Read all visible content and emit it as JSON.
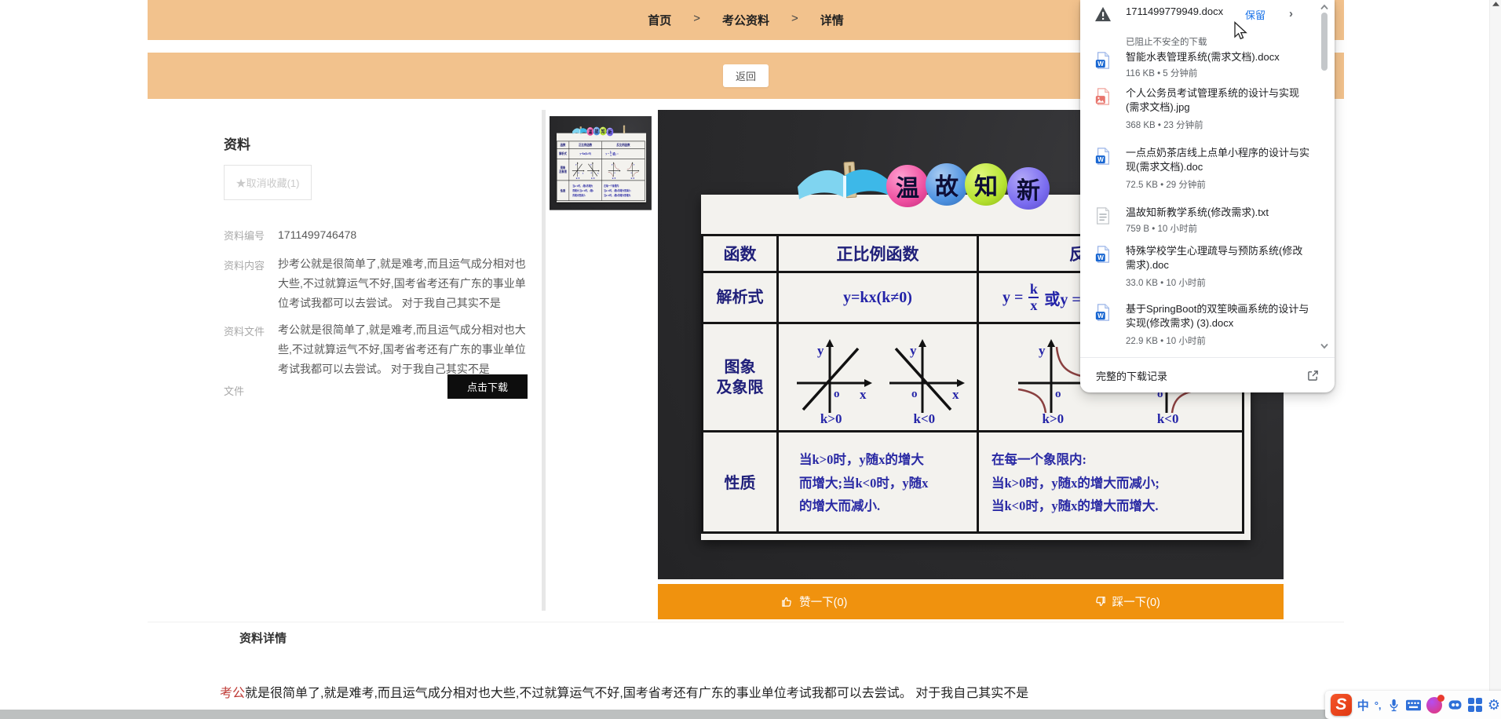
{
  "colors": {
    "header_band": "#f2c28d",
    "accent_orange": "#f0920e",
    "link_blue": "#1a73e8",
    "highlight_red": "#bf3b36",
    "download_button_black": "#0d0d0d"
  },
  "header": {
    "breadcrumb": [
      "首页",
      "考公资料",
      "详情"
    ],
    "separator": ">",
    "back_button": "返回"
  },
  "material_panel": {
    "title": "资料",
    "star_icon": "★",
    "unfavorite_button": "取消收藏(1)",
    "number_label": "资料编号",
    "number_value": "1711499746478",
    "content_label": "资料内容",
    "content_value": "抄考公就是很简单了,就是难考,而且运气成分相对也大些,不过就算运气不好,国考省考还有广东的事业单位考试我都可以去尝试。 对于我自己其实不是",
    "file_desc_label": "资料文件",
    "file_desc_value": "考公就是很简单了,就是难考,而且运气成分相对也大些,不过就算运气不好,国考省考还有广东的事业单位考试我都可以去尝试。 对于我自己其实不是",
    "file_label": "文件",
    "download_button": "点击下载"
  },
  "material_image": {
    "badges": [
      {
        "char": "温",
        "color": "#ee4fa0"
      },
      {
        "char": "故",
        "color": "#4f93e2"
      },
      {
        "char": "知",
        "color": "#b7e432"
      },
      {
        "char": "新",
        "color": "#7a6cf0"
      }
    ],
    "table": {
      "corner": "函数",
      "col2_header": "正比例函数",
      "col3_header": "反比例函数",
      "row2_label": "解析式",
      "row3_label": "图象\n及象限",
      "row4_label": "性质",
      "formula_direct": "y=kx(k≠0)",
      "formula_inverse_pre": "y =",
      "formula_inverse_num": "k",
      "formula_inverse_den": "x",
      "formula_inverse_post": "或y =",
      "axis_y": "y",
      "axis_x": "x",
      "axis_o": "o",
      "k_pos": "k>0",
      "k_neg": "k<0",
      "props_direct": "当k>0时，y随x的增大\n而增大;当k<0时，y随x\n的增大而减小.",
      "props_inverse": "在每一个象限内:\n当k>0时，y随x的增大而减小;\n当k<0时，y随x的增大而增大."
    }
  },
  "vote_bar": {
    "like": "赞一下(0)",
    "dislike": "踩一下(0)"
  },
  "details": {
    "title": "资料详情",
    "highlight": "考公",
    "text": "就是很简单了,就是难考,而且运气成分相对也大些,不过就算运气不好,国考省考还有广东的事业单位考试我都可以去尝试。 对于我自己其实不是"
  },
  "downloads": {
    "items": [
      {
        "name": "1711499779949.docx",
        "status": "已阻止不安全的下载",
        "action": "保留"
      },
      {
        "name": "智能水表管理系统(需求文档).docx",
        "meta": "116 KB • 5 分钟前"
      },
      {
        "name": "个人公务员考试管理系统的设计与实现(需求文档).jpg",
        "meta": "368 KB • 23 分钟前"
      },
      {
        "name": "一点点奶茶店线上点单小程序的设计与实现(需求文档).doc",
        "meta": "72.5 KB • 29 分钟前"
      },
      {
        "name": "温故知新教学系统(修改需求).txt",
        "meta": "759 B • 10 小时前"
      },
      {
        "name": "特殊学校学生心理疏导与预防系统(修改需求).doc",
        "meta": "33.0 KB • 10 小时前"
      },
      {
        "name": "基于SpringBoot的双笙映画系统的设计与实现(修改需求) (3).docx",
        "meta": "22.9 KB • 10 小时前"
      }
    ],
    "footer": "完整的下载记录"
  },
  "ime": {
    "logo": "S",
    "mode": "中",
    "punct": "°,",
    "gear": "⚙"
  }
}
